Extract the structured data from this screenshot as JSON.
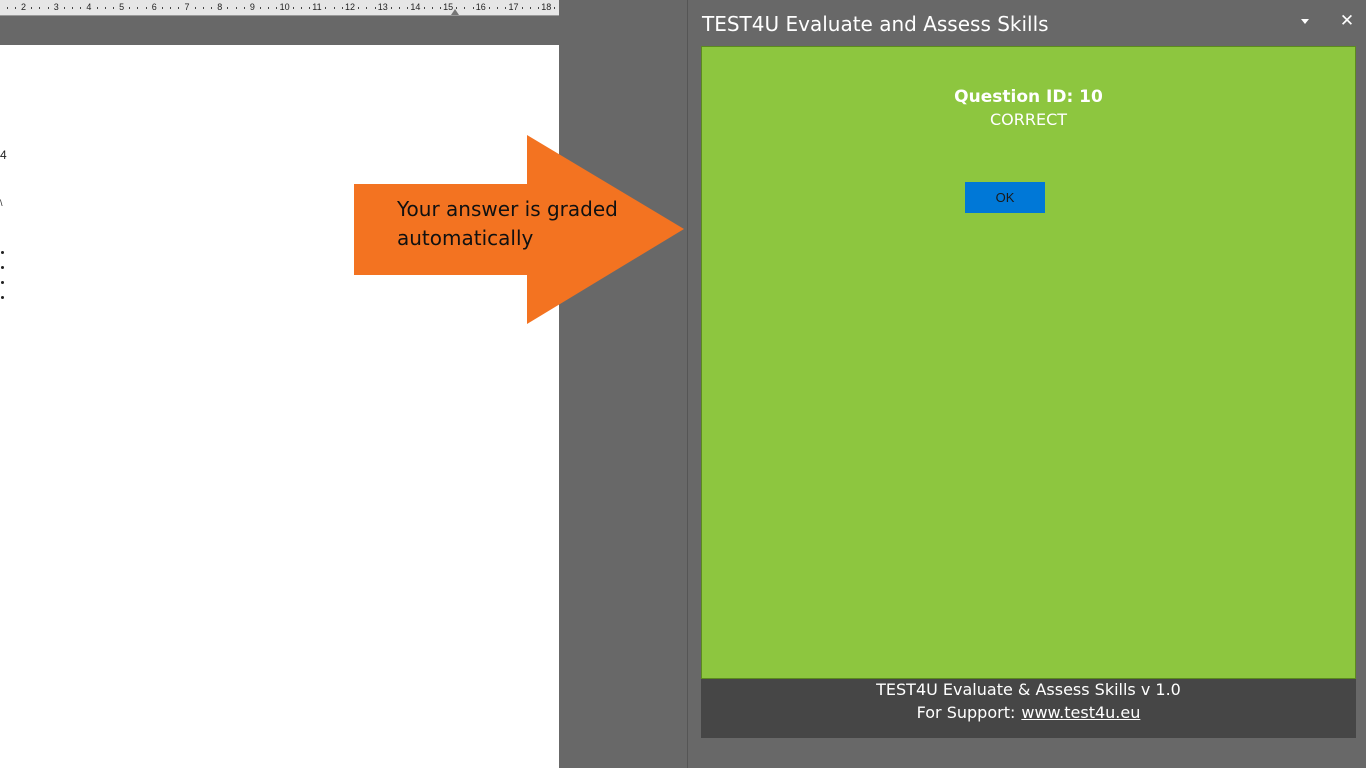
{
  "ruler": {
    "numbers": [
      "2",
      "3",
      "4",
      "5",
      "6",
      "7",
      "8",
      "9",
      "10",
      "11",
      "12",
      "13",
      "14",
      "15",
      "16",
      "17",
      "18"
    ]
  },
  "document": {
    "fragment_1": "4",
    "fragment_2": "\\"
  },
  "callout": {
    "text_line1": "Your answer is graded",
    "text_line2": "automatically",
    "color": "#f37321"
  },
  "pane": {
    "title": "TEST4U Evaluate and Assess Skills",
    "close_glyph": "✕",
    "question_id_label": "Question ID: 10",
    "result": "CORRECT",
    "ok_label": "OK",
    "panel_color": "#8dc63f",
    "button_color": "#0078d7",
    "footer": {
      "version_text": "TEST4U Evaluate & Assess Skills v 1.0",
      "support_label": "For Support:",
      "support_link": "www.test4u.eu"
    }
  }
}
